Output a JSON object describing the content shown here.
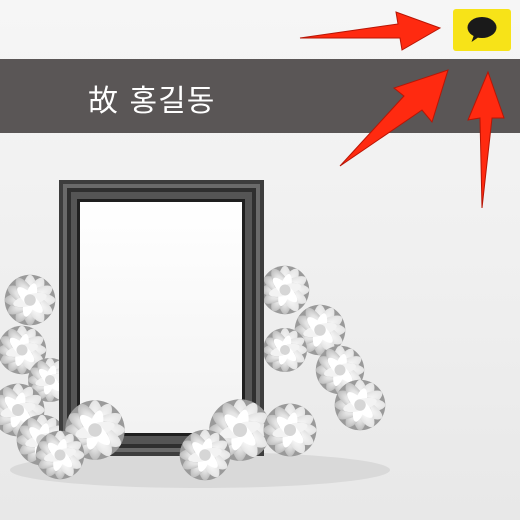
{
  "memorial": {
    "title": "故 홍길동",
    "frame": {
      "photo_empty": true
    },
    "flowers": "white-chrysanthemum"
  },
  "share_button": {
    "icon": "speech-bubble-icon",
    "color": "#f7e318"
  },
  "annotations": {
    "arrow_color": "#ff2a10",
    "arrow_count": 3
  },
  "colors": {
    "title_bar": "#5a5656",
    "background": "#f1f1f1",
    "frame": "#3a3a3a"
  }
}
